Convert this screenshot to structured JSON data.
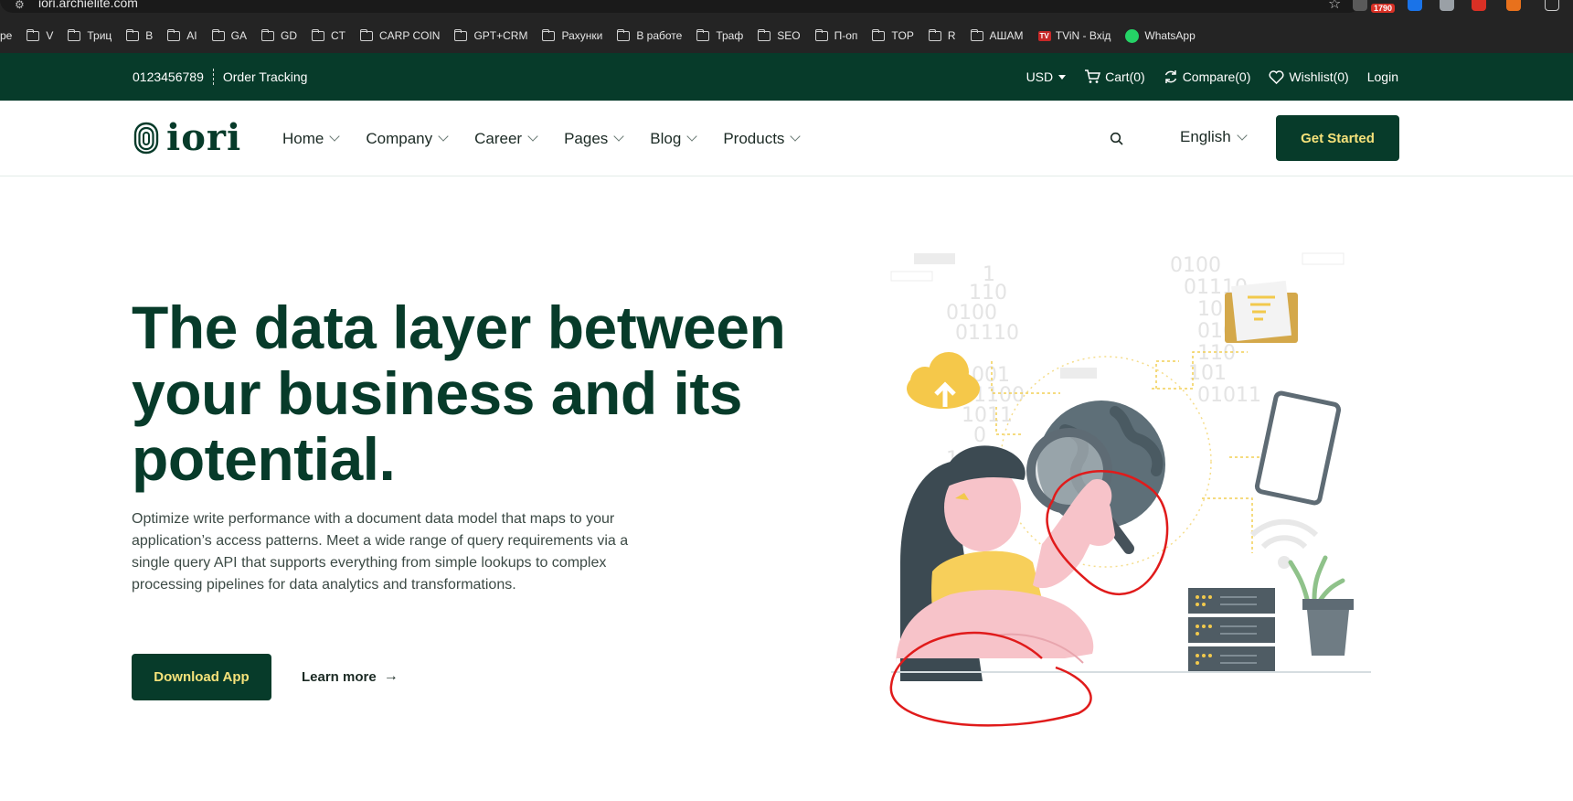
{
  "browser": {
    "url": "iori.archielite.com",
    "extension_badge": "1790",
    "bookmarks": [
      {
        "label": "pe",
        "type": "text"
      },
      {
        "label": "V",
        "type": "folder"
      },
      {
        "label": "Триц",
        "type": "folder"
      },
      {
        "label": "B",
        "type": "folder"
      },
      {
        "label": "AI",
        "type": "folder"
      },
      {
        "label": "GA",
        "type": "folder"
      },
      {
        "label": "GD",
        "type": "folder"
      },
      {
        "label": "CT",
        "type": "folder"
      },
      {
        "label": "CARP COIN",
        "type": "folder"
      },
      {
        "label": "GPT+CRM",
        "type": "folder"
      },
      {
        "label": "Рахунки",
        "type": "folder"
      },
      {
        "label": "В работе",
        "type": "folder"
      },
      {
        "label": "Траф",
        "type": "folder"
      },
      {
        "label": "SEO",
        "type": "folder"
      },
      {
        "label": "П-оп",
        "type": "folder"
      },
      {
        "label": "TOP",
        "type": "folder"
      },
      {
        "label": "R",
        "type": "folder"
      },
      {
        "label": "АШАМ",
        "type": "folder"
      },
      {
        "label": "TViN - Вхід",
        "type": "tv"
      },
      {
        "label": "WhatsApp",
        "type": "whatsapp"
      }
    ]
  },
  "topbar": {
    "phone": "0123456789",
    "order_tracking": "Order Tracking",
    "currency": "USD",
    "cart": "Cart(0)",
    "compare": "Compare(0)",
    "wishlist": "Wishlist(0)",
    "login": "Login"
  },
  "nav": {
    "logo_text": "iori",
    "items": [
      "Home",
      "Company",
      "Career",
      "Pages",
      "Blog",
      "Products"
    ],
    "language": "English",
    "cta": "Get Started"
  },
  "hero": {
    "title_lines": [
      "The data layer between",
      "your business and its",
      "potential."
    ],
    "description": "Optimize write performance with a document data model that maps to your application’s access patterns. Meet a wide range of query requirements via a single query API that supports everything from simple lookups to complex processing pipelines for data analytics and transformations.",
    "download_label": "Download App",
    "learn_label": "Learn more"
  },
  "illustration": {
    "binary_left": [
      "1",
      "110",
      "0100",
      "01110",
      "01001",
      "1100",
      "1011",
      "0",
      "100",
      "1",
      "1"
    ],
    "binary_right": [
      "0100",
      "01110",
      "1010",
      "0100",
      "110",
      "101",
      "01011"
    ]
  },
  "colors": {
    "brand_dark": "#073b2a",
    "accent_yellow": "#f6e27a",
    "annotation_red": "#e01b1b"
  }
}
